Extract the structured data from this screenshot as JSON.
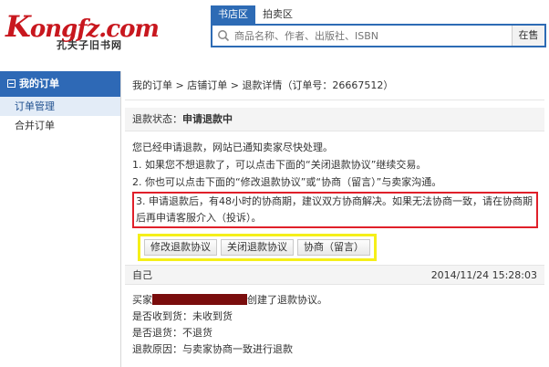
{
  "logo": {
    "main_initial": "K",
    "main_rest": "ongfz.com",
    "subtitle": "孔夫子旧书网"
  },
  "search": {
    "tabs": [
      "书店区",
      "拍卖区"
    ],
    "placeholder": "商品名称、作者、出版社、ISBN",
    "button": "在售"
  },
  "sidebar": {
    "title": "我的订单",
    "items": [
      "订单管理",
      "合并订单"
    ]
  },
  "breadcrumb": {
    "items": [
      "我的订单",
      "店铺订单",
      "退款详情"
    ],
    "order_label": "（订单号：26667512）",
    "separator": ">"
  },
  "status": {
    "label": "退款状态：",
    "value": "申请退款中"
  },
  "messages": {
    "intro": "您已经申请退款，网站已通知卖家尽快处理。",
    "line1": "1. 如果您不想退款了，可以点击下面的“关闭退款协议”继续交易。",
    "line2": "2. 你也可以点击下面的“修改退款协议”或“协商（留言）”与卖家沟通。",
    "line3": "3. 申请退款后，有48小时的协商期，建议双方协商解决。如果无法协商一致，请在协商期后再申请客服介入（投诉）。"
  },
  "actions": {
    "modify": "修改退款协议",
    "close": "关闭退款协议",
    "negotiate": "协商（留言）"
  },
  "log": {
    "author": "自己",
    "time": "2014/11/24 15:28:03",
    "buyer_prefix": "买家",
    "buyer_suffix": "创建了退款协议。",
    "received": "是否收到货：未收到货",
    "return": "是否退货：不退货",
    "reason": "退款原因：与卖家协商一致进行退款"
  },
  "colors": {
    "brand_red": "#c8171e",
    "nav_blue": "#2e69b6",
    "highlight_red": "#e0202a",
    "highlight_yellow": "#f5ef19"
  }
}
